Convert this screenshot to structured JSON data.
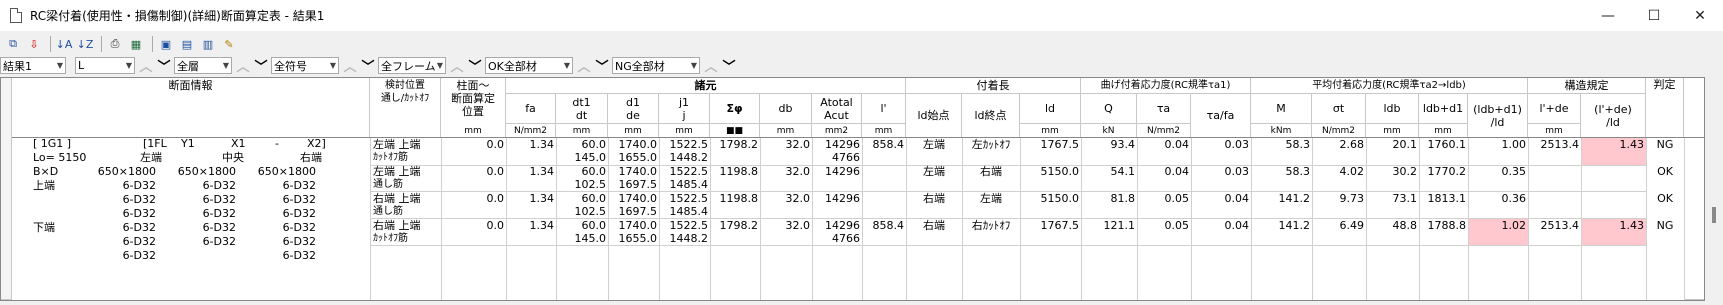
{
  "window": {
    "title": "RC梁付着(使用性・損傷制御)(詳細)断面算定表 - 結果1",
    "minimize": "—",
    "maximize": "☐",
    "close": "✕"
  },
  "toolbar": {
    "icons": [
      "copy-icon",
      "export-icon",
      "sort-asc-icon",
      "sort-desc-icon",
      "print-icon",
      "excel-icon",
      "window-icon",
      "window2-icon",
      "chart-icon",
      "notes-icon"
    ]
  },
  "filters": {
    "result": "結果1",
    "direction": "L",
    "floor": "全層",
    "symbol": "全符号",
    "frame": "全フレーム",
    "ok_filter": "OK全部材",
    "ng_filter": "NG全部材"
  },
  "headers": {
    "section_info": "断面情報",
    "check_pos": "検討位置\n通し/ｶｯﾄｵﾌ",
    "col_face": "柱面～\n断面算定\n位置",
    "specs": "諸元",
    "bond_len": "付着長",
    "bend_stress": "曲げ付着応力度(RC規準τa1)",
    "avg_stress": "平均付着応力度(RC規準τa2→ldb)",
    "struct_rule": "構造規定",
    "judge": "判定",
    "fa": "fa",
    "dt1": "dt1\ndt",
    "d1": "d1\nde",
    "j1": "j1\nj",
    "sumphi": "Σφ",
    "db": "db",
    "atotal": "Atotal\nAcut",
    "lprime": "l'",
    "ld_start": "ld始点",
    "ld_end": "ld終点",
    "ld": "ld",
    "Q": "Q",
    "ta": "τa",
    "tafa": "τa/fa",
    "M": "M",
    "st": "σt",
    "ldb": "ldb",
    "ldbd1": "ldb+d1",
    "ratio1": "(ldb+d1)\n/ld",
    "lde": "l'+de",
    "ratio2": "(l'+de)\n/ld"
  },
  "units": {
    "colface": "mm",
    "fa": "N/mm2",
    "dt1": "mm",
    "d1": "mm",
    "j1": "mm",
    "sumphi": "■■",
    "db": "mm",
    "atotal": "mm2",
    "lprime": "mm",
    "ld": "mm",
    "Q": "kN",
    "ta": "N/mm2",
    "M": "kNm",
    "st": "N/mm2",
    "ldb": "mm",
    "ldbd1": "mm",
    "lde": "mm"
  },
  "section": {
    "l1": {
      "a": "[ 1G1 ]",
      "b": "[1FL",
      "c": "Y1",
      "d": "X1",
      "e": "-",
      "f": "X2]"
    },
    "l2": {
      "a": "Lo= 5150",
      "b": "左端",
      "c": "中央",
      "d": "右端"
    },
    "l3": {
      "a": "B×D",
      "b": "650×1800",
      "c": "650×1800",
      "d": "650×1800"
    },
    "l4": {
      "a": "上端",
      "b": "6-D32",
      "c": "6-D32",
      "d": "6-D32"
    },
    "l5": {
      "b": "6-D32",
      "c": "6-D32",
      "d": "6-D32"
    },
    "l6": {
      "b": "6-D32",
      "c": "6-D32",
      "d": "6-D32"
    },
    "l7": {
      "a": "下端",
      "b": "6-D32",
      "c": "6-D32",
      "d": "6-D32"
    },
    "l8": {
      "b": "6-D32",
      "c": "6-D32",
      "d": "6-D32"
    },
    "l9": {
      "b": "6-D32",
      "c": "",
      "d": "6-D32"
    }
  },
  "rows": [
    {
      "pos1": "左端 上端",
      "pos2": "ｶｯﾄｵﾌ筋",
      "colface": "0.0",
      "fa": "1.34",
      "dt1": "60.0",
      "dt": "145.0",
      "d1": "1740.0",
      "de": "1655.0",
      "j1": "1522.5",
      "j": "1448.2",
      "sumphi": "1798.2",
      "db": "32.0",
      "atotal": "14296",
      "acut": "4766",
      "lprime": "858.4",
      "ldstart": "左端",
      "ldend": "左ｶｯﾄｵﾌ",
      "ld": "1767.5",
      "Q": "93.4",
      "ta": "0.04",
      "tafa": "0.03",
      "M": "58.3",
      "st": "2.68",
      "ldb": "20.1",
      "ldbd1": "1760.1",
      "ratio1": "1.00",
      "lde": "2513.4",
      "ratio2": "1.43",
      "judge": "NG"
    },
    {
      "pos1": "左端 上端",
      "pos2": "通し筋",
      "colface": "0.0",
      "fa": "1.34",
      "dt1": "60.0",
      "dt": "102.5",
      "d1": "1740.0",
      "de": "1697.5",
      "j1": "1522.5",
      "j": "1485.4",
      "sumphi": "1198.8",
      "db": "32.0",
      "atotal": "14296",
      "acut": "",
      "lprime": "",
      "ldstart": "左端",
      "ldend": "右端",
      "ld": "5150.0",
      "Q": "54.1",
      "ta": "0.04",
      "tafa": "0.03",
      "M": "58.3",
      "st": "4.02",
      "ldb": "30.2",
      "ldbd1": "1770.2",
      "ratio1": "0.35",
      "lde": "",
      "ratio2": "",
      "judge": "OK"
    },
    {
      "pos1": "右端 上端",
      "pos2": "通し筋",
      "colface": "0.0",
      "fa": "1.34",
      "dt1": "60.0",
      "dt": "102.5",
      "d1": "1740.0",
      "de": "1697.5",
      "j1": "1522.5",
      "j": "1485.4",
      "sumphi": "1198.8",
      "db": "32.0",
      "atotal": "14296",
      "acut": "",
      "lprime": "",
      "ldstart": "右端",
      "ldend": "左端",
      "ld": "5150.0",
      "Q": "81.8",
      "ta": "0.05",
      "tafa": "0.04",
      "M": "141.2",
      "st": "9.73",
      "ldb": "73.1",
      "ldbd1": "1813.1",
      "ratio1": "0.36",
      "lde": "",
      "ratio2": "",
      "judge": "OK"
    },
    {
      "pos1": "右端 上端",
      "pos2": "ｶｯﾄｵﾌ筋",
      "colface": "0.0",
      "fa": "1.34",
      "dt1": "60.0",
      "dt": "145.0",
      "d1": "1740.0",
      "de": "1655.0",
      "j1": "1522.5",
      "j": "1448.2",
      "sumphi": "1798.2",
      "db": "32.0",
      "atotal": "14296",
      "acut": "4766",
      "lprime": "858.4",
      "ldstart": "右端",
      "ldend": "右ｶｯﾄｵﾌ",
      "ld": "1767.5",
      "Q": "121.1",
      "ta": "0.05",
      "tafa": "0.04",
      "M": "141.2",
      "st": "6.49",
      "ldb": "48.8",
      "ldbd1": "1788.8",
      "ratio1": "1.02",
      "lde": "2513.4",
      "ratio2": "1.43",
      "judge": "NG"
    }
  ],
  "colors": {
    "ng_highlight": "#ffc7ce"
  }
}
